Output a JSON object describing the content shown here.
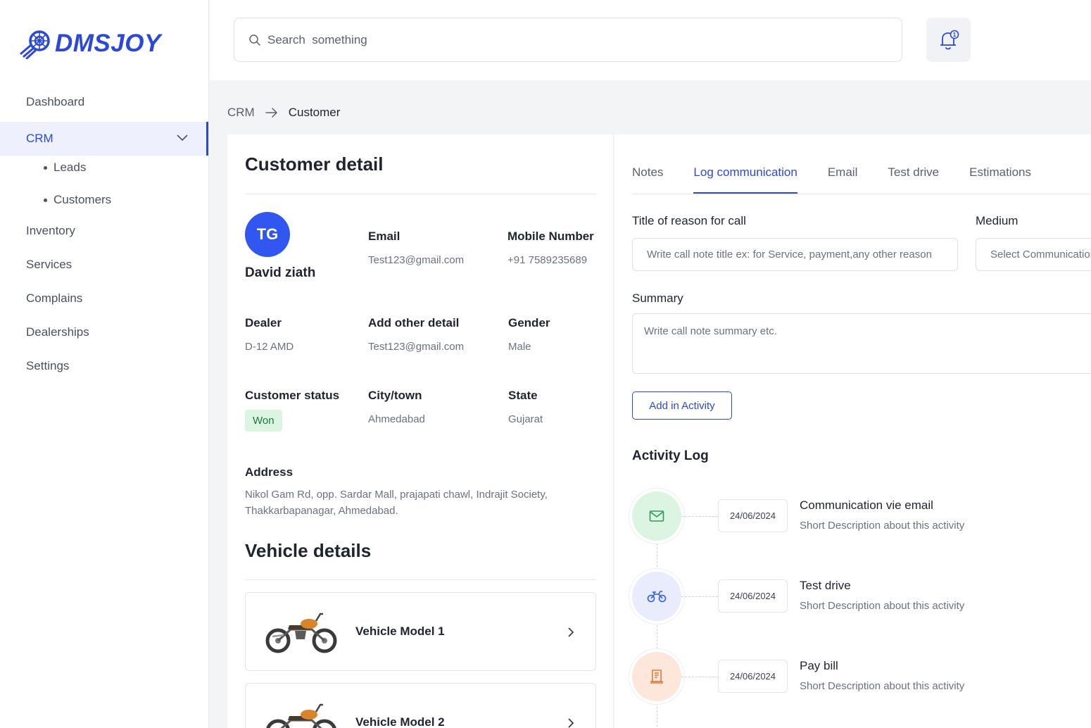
{
  "brand": {
    "name": "DMSJOY",
    "color": "#2b49d6"
  },
  "sidebar": {
    "items": [
      {
        "label": "Dashboard"
      },
      {
        "label": "CRM",
        "active": true
      },
      {
        "label": "Inventory"
      },
      {
        "label": "Services"
      },
      {
        "label": "Complains"
      },
      {
        "label": "Dealerships"
      },
      {
        "label": "Settings"
      }
    ],
    "crm_sub": [
      {
        "label": "Leads"
      },
      {
        "label": "Customers"
      }
    ]
  },
  "search": {
    "placeholder": "Search  something",
    "icon": "search-icon"
  },
  "notification": {
    "icon": "bell-icon",
    "count": "1"
  },
  "breadcrumb": {
    "parent": "CRM",
    "current": "Customer"
  },
  "customer": {
    "section_title": "Customer detail",
    "initials": "TG",
    "name": "David ziath",
    "email_label": "Email",
    "email": "Test123@gmail.com",
    "mobile_label": "Mobile Number",
    "mobile": "+91 7589235689",
    "dealer_label": "Dealer",
    "dealer": "D-12 AMD",
    "other_label": "Add other detail",
    "other": "Test123@gmail.com",
    "gender_label": "Gender",
    "gender": "Male",
    "status_label": "Customer status",
    "status": "Won",
    "city_label": "City/town",
    "city": "Ahmedabad",
    "state_label": "State",
    "state": "Gujarat",
    "address_label": "Address",
    "address": "Nikol Gam Rd, opp. Sardar Mall, prajapati chawl, Indrajit Society, Thakkarbapanagar, Ahmedabad."
  },
  "vehicles": {
    "section_title": "Vehicle details",
    "items": [
      {
        "name": "Vehicle Model 1"
      },
      {
        "name": "Vehicle Model 2"
      }
    ]
  },
  "tabs": [
    {
      "label": "Notes"
    },
    {
      "label": "Log communication",
      "active": true
    },
    {
      "label": "Email"
    },
    {
      "label": "Test drive"
    },
    {
      "label": "Estimations"
    }
  ],
  "log_form": {
    "title_label": "Title of reason for call",
    "title_placeholder": "Write call note title ex: for Service, payment,any other reason",
    "medium_label": "Medium",
    "medium_placeholder": "Select Communication",
    "summary_label": "Summary",
    "summary_placeholder": "Write call note summary etc.",
    "add_button": "Add in Activity"
  },
  "activity": {
    "title": "Activity Log",
    "items": [
      {
        "date": "24/06/2024",
        "title": "Communication vie email",
        "desc": "Short Description about this activity",
        "icon": "mail-icon",
        "color": "#dcf5e3"
      },
      {
        "date": "24/06/2024",
        "title": "Test drive",
        "desc": "Short Description about this activity",
        "icon": "motorcycle-icon",
        "color": "#e8ecfd"
      },
      {
        "date": "24/06/2024",
        "title": "Pay bill",
        "desc": "Short Description about this activity",
        "icon": "receipt-icon",
        "color": "#fde6da"
      }
    ]
  }
}
